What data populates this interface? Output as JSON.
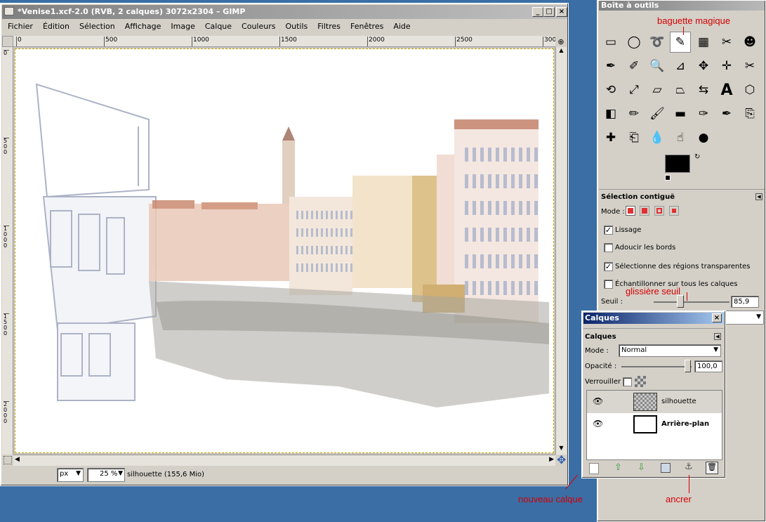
{
  "image_window": {
    "title": "*Venise1.xcf-2.0 (RVB, 2 calques) 3072x2304 – GIMP",
    "menu": [
      "Fichier",
      "Édition",
      "Sélection",
      "Affichage",
      "Image",
      "Calque",
      "Couleurs",
      "Outils",
      "Filtres",
      "Fenêtres",
      "Aide"
    ],
    "ruler_h": [
      "0",
      "500",
      "1000",
      "1500",
      "2000",
      "2500",
      "300"
    ],
    "ruler_v": [
      "0",
      "500",
      "1000",
      "1500",
      "2000"
    ],
    "status": {
      "unit": "px",
      "zoom": "25 %",
      "info": "silhouette (155,6 Mio)"
    }
  },
  "toolbox": {
    "title": "Boîte à outils",
    "tools": [
      "rect-select",
      "ellipse-select",
      "free-select",
      "fuzzy-select",
      "select-by-color",
      "scissors",
      "foreground-select",
      "paths",
      "color-picker",
      "zoom",
      "measure",
      "move",
      "align",
      "crop",
      "rotate",
      "scale",
      "shear",
      "perspective",
      "flip",
      "text",
      "cage",
      "blend",
      "pencil",
      "paintbrush",
      "eraser",
      "airbrush",
      "ink",
      "clone",
      "heal",
      "perspective-clone",
      "blur",
      "smudge",
      "dodge"
    ],
    "options_title": "Sélection contiguë",
    "mode_label": "Mode :",
    "options": [
      {
        "label": "Lissage",
        "checked": true
      },
      {
        "label": "Adoucir les bords",
        "checked": false
      },
      {
        "label": "Sélectionne des régions transparentes",
        "checked": true
      },
      {
        "label": "Échantillonner sur tous les calques",
        "checked": false
      }
    ],
    "threshold_label": "Seuil :",
    "threshold_value": "85,9"
  },
  "layers_dialog": {
    "title": "Calques",
    "header": "Calques",
    "mode_label": "Mode :",
    "mode_value": "Normal",
    "opacity_label": "Opacité :",
    "opacity_value": "100,0",
    "lock_label": "Verrouiller :",
    "layers": [
      {
        "name": "silhouette",
        "bold": false
      },
      {
        "name": "Arrière-plan",
        "bold": true
      }
    ]
  },
  "annotations": {
    "magic_wand": "baguette magique",
    "threshold_slider": "glissière seuil",
    "new_layer": "nouveau calque",
    "anchor": "ancrer"
  },
  "colors": {
    "titlebar_active": "#0a246a",
    "titlebar_inactive": "#808080",
    "annotation": "#d40000",
    "desktop": "#3a6ea5"
  }
}
